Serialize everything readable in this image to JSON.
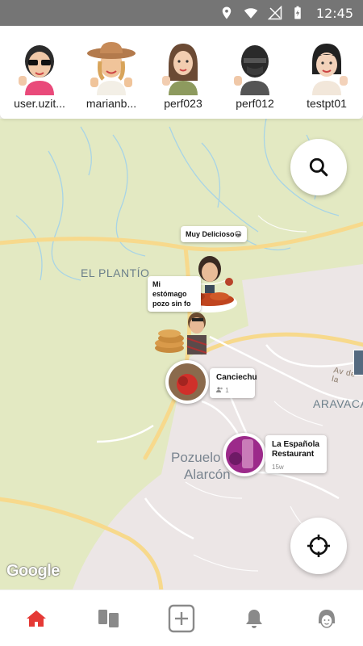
{
  "status_bar": {
    "time": "12:45",
    "icons": [
      "location-icon",
      "wifi-icon",
      "no-signal-icon",
      "battery-charging-icon"
    ]
  },
  "friends": [
    {
      "name": "user.uzit...",
      "icon": "avatar-sunglasses"
    },
    {
      "name": "marianb...",
      "icon": "avatar-hat"
    },
    {
      "name": "perf023",
      "icon": "avatar-long-hair"
    },
    {
      "name": "perf012",
      "icon": "avatar-helmet"
    },
    {
      "name": "testpt01",
      "icon": "avatar-bob"
    }
  ],
  "map": {
    "labels": {
      "el_plantio": "EL PLANTÍO",
      "aravaca": "ARAVACA",
      "pozuelo": "Pozuelo",
      "alarcon": "Alarcón",
      "avenue": "Av de la"
    },
    "bubbles": {
      "muy_delicioso": "Muy Delicioso😀",
      "mi_estomago": "Mi estómago pozo sin fo"
    },
    "places": [
      {
        "title": "Canciechu",
        "sub": "1"
      },
      {
        "title": "La Española Restaurant",
        "sub": "15w"
      }
    ],
    "attribution": "Google"
  },
  "colors": {
    "accent": "#e53935",
    "map_green": "#e3e9c2",
    "map_pink": "#ece6e6",
    "road": "#f7d98c"
  },
  "nav": [
    {
      "name": "home",
      "icon": "home-icon",
      "active": true
    },
    {
      "name": "feed",
      "icon": "cards-icon"
    },
    {
      "name": "add",
      "icon": "plus-square-icon"
    },
    {
      "name": "notifications",
      "icon": "bell-icon"
    },
    {
      "name": "profile",
      "icon": "profile-avatar-icon"
    }
  ]
}
